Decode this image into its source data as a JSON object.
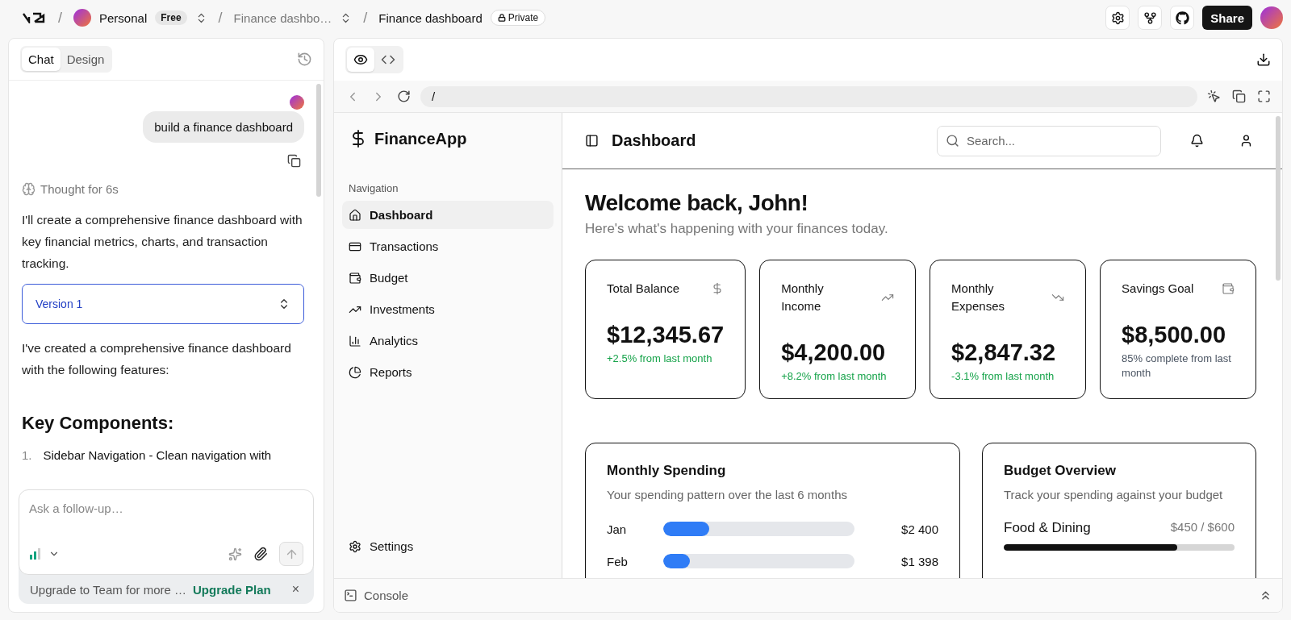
{
  "topbar": {
    "separator": "/",
    "workspace": {
      "name": "Personal",
      "plan": "Free"
    },
    "project": "Finance dashbo…",
    "chat_title": "Finance dashboard",
    "visibility": "Private",
    "share": "Share"
  },
  "chat_panel": {
    "tabs": [
      {
        "label": "Chat",
        "selected": true
      },
      {
        "label": "Design",
        "selected": false
      }
    ],
    "user_message": "build a finance dashboard",
    "thought": "Thought for 6s",
    "intro": "I'll create a comprehensive finance dashboard with key financial metrics, charts, and transaction tracking.",
    "version": "Version 1",
    "summary": "I've created a comprehensive finance dashboard with the following features:",
    "heading": "Key Components:",
    "list": [
      {
        "number": "1.",
        "text": "Sidebar Navigation - Clean navigation with"
      }
    ],
    "composer": {
      "placeholder": "Ask a follow-up…"
    },
    "upgrade": {
      "text": "Upgrade to Team for more …",
      "link": "Upgrade Plan",
      "close": "×"
    }
  },
  "preview": {
    "view_modes": [
      {
        "kind": "preview",
        "selected": true
      },
      {
        "kind": "code",
        "selected": false
      }
    ],
    "url": "/",
    "console": "Console",
    "app": {
      "brand": "FinanceApp",
      "nav_label": "Navigation",
      "nav": [
        {
          "label": "Dashboard",
          "kind": "home",
          "selected": true
        },
        {
          "label": "Transactions",
          "kind": "card",
          "selected": false
        },
        {
          "label": "Budget",
          "kind": "wallet",
          "selected": false
        },
        {
          "label": "Investments",
          "kind": "trend-up",
          "selected": false
        },
        {
          "label": "Analytics",
          "kind": "bars",
          "selected": false
        },
        {
          "label": "Reports",
          "kind": "pie",
          "selected": false
        }
      ],
      "settings": "Settings",
      "title": "Dashboard",
      "search": {
        "placeholder": "Search..."
      },
      "welcome": "Welcome back, John!",
      "subtitle": "Here's what's happening with your finances today.",
      "stats": [
        {
          "title": "Total Balance",
          "kind": "dollar",
          "value": "$12,345.67",
          "change": "+2.5% from last month",
          "color": "#16a34a"
        },
        {
          "title": "Monthly Income",
          "kind": "trend-up",
          "value": "$4,200.00",
          "change": "+8.2% from last month",
          "color": "#16a34a"
        },
        {
          "title": "Monthly Expenses",
          "kind": "trend-down",
          "value": "$2,847.32",
          "change": "-3.1% from last month",
          "color": "#16a34a"
        },
        {
          "title": "Savings Goal",
          "kind": "wallet",
          "value": "$8,500.00",
          "change": "85% complete from last month",
          "color": "#4b5563"
        }
      ],
      "spending": {
        "title": "Monthly Spending",
        "subtitle": "Your spending pattern over the last 6 months",
        "months": [
          {
            "month": "Jan",
            "level": 0.24,
            "amount": "$2 400"
          },
          {
            "month": "Feb",
            "level": 0.14,
            "amount": "$1 398"
          }
        ]
      },
      "budget": {
        "title": "Budget Overview",
        "subtitle": "Track your spending against your budget",
        "items": [
          {
            "name": "Food & Dining",
            "amount": "$450 / $600",
            "level": 0.75
          }
        ]
      }
    }
  }
}
